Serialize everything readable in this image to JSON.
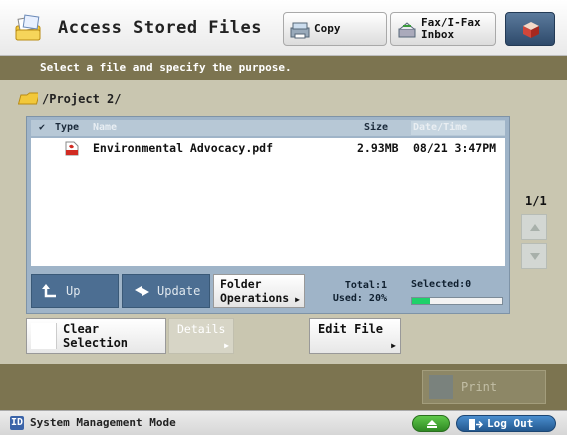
{
  "header": {
    "title": "Access Stored Files",
    "copy_label": "Copy",
    "fax_label": "Fax/I-Fax Inbox"
  },
  "instruction": "Select a file and specify the purpose.",
  "breadcrumb": "/Project 2/",
  "list": {
    "columns": {
      "type": "Type",
      "name": "Name",
      "size": "Size",
      "date": "Date/Time"
    },
    "rows": [
      {
        "name": "Environmental Advocacy.pdf",
        "size": "2.93MB",
        "date": "08/21 3:47PM"
      }
    ]
  },
  "panel_buttons": {
    "up": "Up",
    "update": "Update",
    "folder_ops": "Folder Operations"
  },
  "stats": {
    "total": "Total:1",
    "used": "Used: 20%",
    "selected": "Selected:0",
    "used_fraction": 0.2
  },
  "pager": {
    "page": "1/1"
  },
  "actions": {
    "clear": "Clear Selection",
    "details": "Details",
    "edit": "Edit File",
    "print": "Print"
  },
  "footer": {
    "mode": "System Management Mode",
    "logout": "Log Out"
  },
  "colors": {
    "accent_bar": "#7c7450",
    "panel": "#9fb4c8",
    "usage": "#1fd16a"
  }
}
